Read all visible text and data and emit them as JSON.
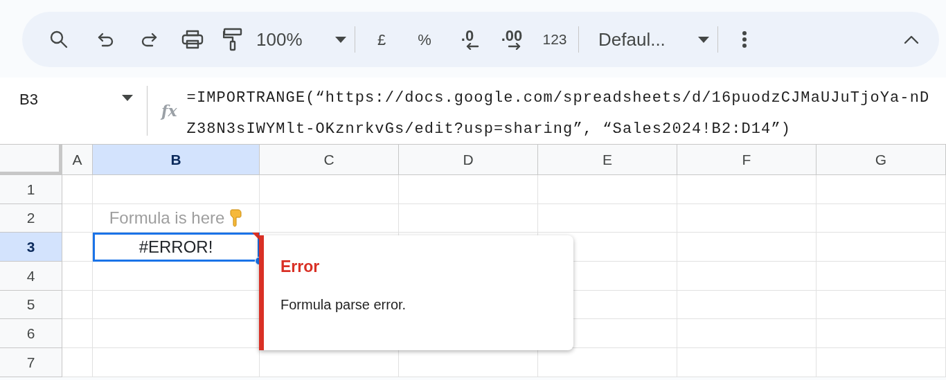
{
  "toolbar": {
    "zoom": "100%",
    "currency": "£",
    "percent": "%",
    "decrease_decimal": ".0",
    "increase_decimal": ".00",
    "number_format": "123",
    "font": "Defaul..."
  },
  "formula_bar": {
    "cell_reference": "B3",
    "fx_label": "fx",
    "formula": "=IMPORTRANGE(“https://docs.google.com/spreadsheets/d/16puodzCJMaUJuTjoYa-nDZ38N3sIWYMlt-OKznrkvGs/edit?usp=sharing”, “Sales2024!B2:D14”)"
  },
  "columns": [
    {
      "label": "A",
      "selected": false
    },
    {
      "label": "B",
      "selected": true
    },
    {
      "label": "C",
      "selected": false
    },
    {
      "label": "D",
      "selected": false
    },
    {
      "label": "E",
      "selected": false
    },
    {
      "label": "F",
      "selected": false
    },
    {
      "label": "G",
      "selected": false
    }
  ],
  "rows": [
    {
      "label": "1",
      "selected": false
    },
    {
      "label": "2",
      "selected": false,
      "column_b": {
        "text": "Formula is here",
        "kind": "note",
        "selected": false,
        "error": false
      }
    },
    {
      "label": "3",
      "selected": true,
      "column_b": {
        "text": "#ERROR!",
        "kind": "value",
        "selected": true,
        "error": true
      }
    },
    {
      "label": "4",
      "selected": false
    },
    {
      "label": "5",
      "selected": false
    },
    {
      "label": "6",
      "selected": false
    },
    {
      "label": "7",
      "selected": false
    }
  ],
  "error_popup": {
    "title": "Error",
    "message": "Formula parse error."
  }
}
